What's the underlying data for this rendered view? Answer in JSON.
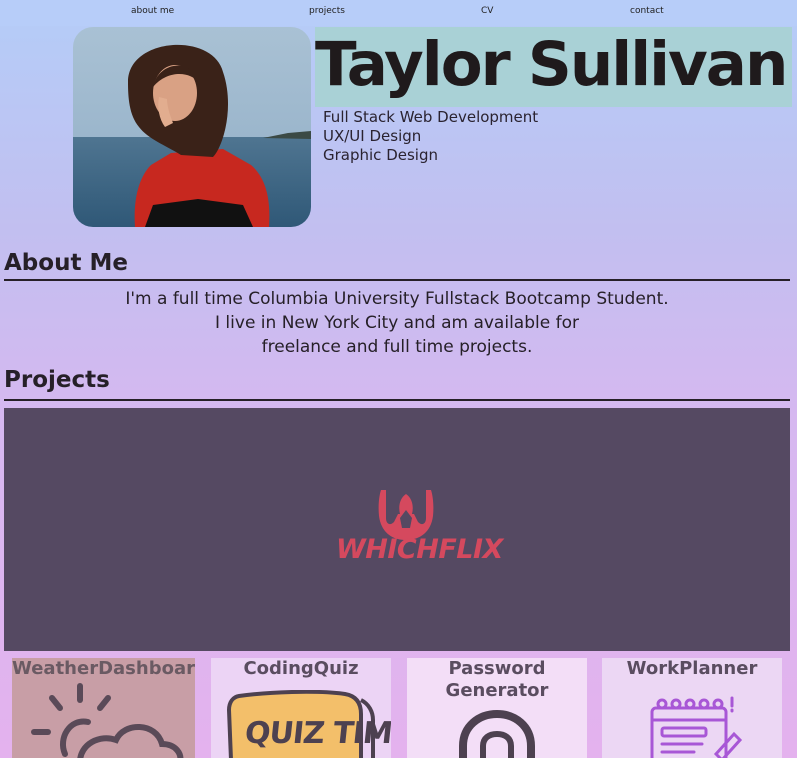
{
  "nav": {
    "about": "about me",
    "projects": "projects",
    "cv": "CV",
    "contact": "contact"
  },
  "header": {
    "name": "Taylor Sullivan",
    "roles": [
      "Full Stack Web Development",
      "UX/UI Design",
      "Graphic Design"
    ]
  },
  "about": {
    "heading": "About Me",
    "lines": [
      "I'm a full time Columbia University Fullstack Bootcamp Student.",
      "I live in New York City and am available for",
      "freelance and full time projects."
    ]
  },
  "projects": {
    "heading": "Projects",
    "featured_logo_text": "WHICHFLIX",
    "cards": [
      {
        "title": "WeatherDashboard"
      },
      {
        "title": "CodingQuiz",
        "image_text": "QUIZ TIME"
      },
      {
        "title_line1": "Password",
        "title_line2": "Generator"
      },
      {
        "title": "WorkPlanner"
      }
    ]
  },
  "colors": {
    "nav_bg": "#b7cdf9",
    "title_bg": "#a9d1d6",
    "featured_bg": "#554962",
    "whichflix_red": "#d5495e"
  }
}
